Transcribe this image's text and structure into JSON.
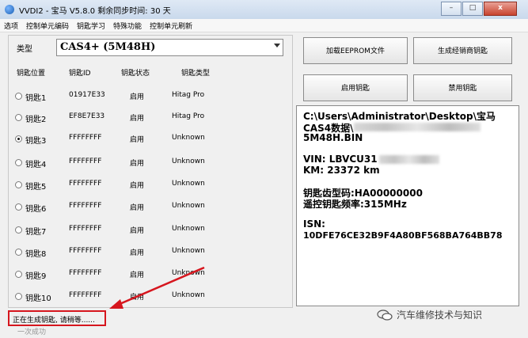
{
  "window": {
    "title": "VVDI2 - 宝马 V5.8.0    剩余同步时间: 30 天",
    "controls": {
      "minimize": "–",
      "maximize": "□",
      "close": "x"
    }
  },
  "menu": [
    "选项",
    "控制单元编码",
    "钥匙学习",
    "特殊功能",
    "控制单元刷新"
  ],
  "left": {
    "type_label": "类型",
    "type_value": "CAS4+ (5M48H)",
    "headers": [
      "钥匙位置",
      "钥匙ID",
      "钥匙状态",
      "钥匙类型"
    ],
    "keys": [
      {
        "name": "钥匙1",
        "id": "01917E33",
        "status": "启用",
        "type": "Hitag Pro",
        "checked": false
      },
      {
        "name": "钥匙2",
        "id": "EF8E7E33",
        "status": "启用",
        "type": "Hitag Pro",
        "checked": false
      },
      {
        "name": "钥匙3",
        "id": "FFFFFFFF",
        "status": "启用",
        "type": "Unknown",
        "checked": true
      },
      {
        "name": "钥匙4",
        "id": "FFFFFFFF",
        "status": "启用",
        "type": "Unknown",
        "checked": false
      },
      {
        "name": "钥匙5",
        "id": "FFFFFFFF",
        "status": "启用",
        "type": "Unknown",
        "checked": false
      },
      {
        "name": "钥匙6",
        "id": "FFFFFFFF",
        "status": "启用",
        "type": "Unknown",
        "checked": false
      },
      {
        "name": "钥匙7",
        "id": "FFFFFFFF",
        "status": "启用",
        "type": "Unknown",
        "checked": false
      },
      {
        "name": "钥匙8",
        "id": "FFFFFFFF",
        "status": "启用",
        "type": "Unknown",
        "checked": false
      },
      {
        "name": "钥匙9",
        "id": "FFFFFFFF",
        "status": "启用",
        "type": "Unknown",
        "checked": false
      },
      {
        "name": "钥匙10",
        "id": "FFFFFFFF",
        "status": "启用",
        "type": "Unknown",
        "checked": false
      }
    ]
  },
  "buttons": {
    "load_eeprom": "加载EEPROM文件",
    "gen_dealer_key": "生成经销商钥匙",
    "enable_key": "启用钥匙",
    "disable_key": "禁用钥匙"
  },
  "info": {
    "path_1": "C:\\Users\\Administrator\\Desktop\\宝马",
    "path_2": "CAS4数据\\",
    "path_3": "5M48H.BIN",
    "vin": "VIN: LBVCU31",
    "km": "KM:  23372 km",
    "key_tooth": "钥匙齿型码:HA00000000",
    "remote_freq": "遥控钥匙频率:315MHz",
    "isn_label": "ISN:",
    "isn_value": "10DFE76CE32B9F4A80BF568BA764BB78"
  },
  "status": {
    "text": "正在生成钥匙, 请稍等......",
    "footer": "一次成功"
  },
  "watermark": "汽车维修技术与知识",
  "colors": {
    "highlight": "#d6161e"
  }
}
